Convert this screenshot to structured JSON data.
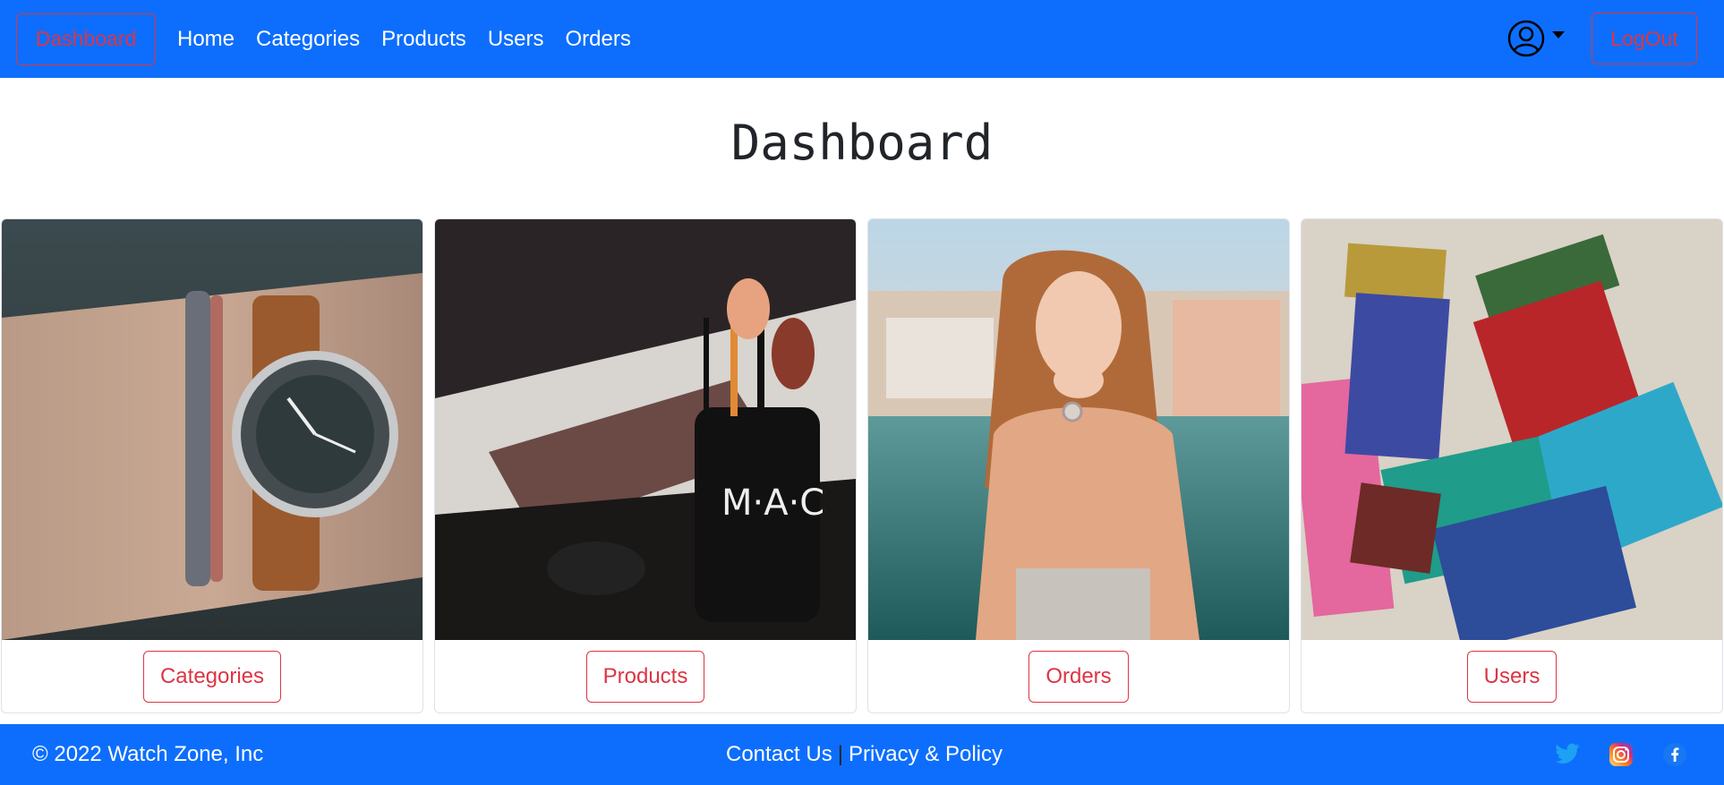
{
  "nav": {
    "dashboard_label": "Dashboard",
    "links": [
      "Home",
      "Categories",
      "Products",
      "Users",
      "Orders"
    ],
    "user_icon": "user-circle-icon",
    "logout_label": "LogOut"
  },
  "page": {
    "title": "Dashboard"
  },
  "cards": [
    {
      "image": "wristwatch-photo",
      "button": "Categories"
    },
    {
      "image": "makeup-brushes-photo",
      "button": "Products"
    },
    {
      "image": "woman-with-watch-photo",
      "button": "Orders"
    },
    {
      "image": "paint-brushes-photo",
      "button": "Users"
    }
  ],
  "footer": {
    "copyright": "© 2022 Watch Zone, Inc",
    "contact": "Contact Us",
    "separator": "|",
    "privacy": "Privacy & Policy",
    "social": [
      "twitter-icon",
      "instagram-icon",
      "facebook-icon"
    ]
  },
  "colors": {
    "primary": "#0d6efd",
    "danger": "#dc3545",
    "twitter": "#1da1f2"
  }
}
